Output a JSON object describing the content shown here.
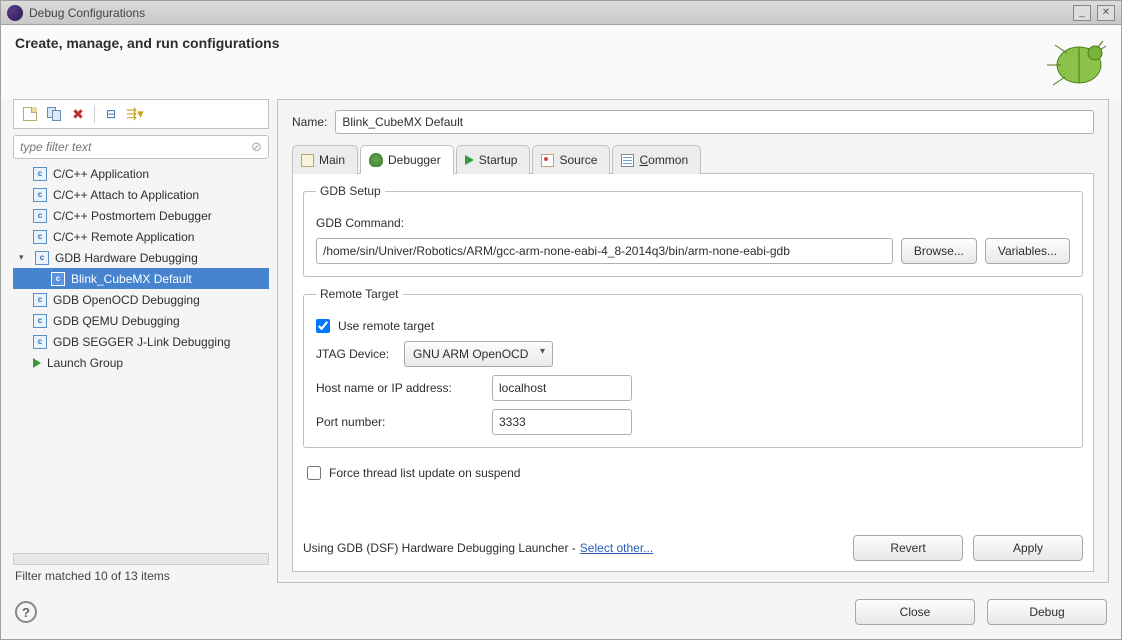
{
  "window": {
    "title": "Debug Configurations"
  },
  "header": {
    "title": "Create, manage, and run configurations"
  },
  "filter": {
    "placeholder": "type filter text"
  },
  "tree": {
    "items": [
      {
        "label": "C/C++ Application"
      },
      {
        "label": "C/C++ Attach to Application"
      },
      {
        "label": "C/C++ Postmortem Debugger"
      },
      {
        "label": "C/C++ Remote Application"
      },
      {
        "label": "GDB Hardware Debugging",
        "expanded": true
      },
      {
        "label": "Blink_CubeMX Default",
        "selected": true
      },
      {
        "label": "GDB OpenOCD Debugging"
      },
      {
        "label": "GDB QEMU Debugging"
      },
      {
        "label": "GDB SEGGER J-Link Debugging"
      },
      {
        "label": "Launch Group",
        "launch": true
      }
    ]
  },
  "filter_status": "Filter matched 10 of 13 items",
  "name": {
    "label": "Name:",
    "value": "Blink_CubeMX Default"
  },
  "tabs": {
    "main": "Main",
    "debugger": "Debugger",
    "startup": "Startup",
    "source": "Source",
    "common": "Common"
  },
  "gdb_setup": {
    "legend": "GDB Setup",
    "command_label": "GDB Command:",
    "command_value": "/home/sin/Univer/Robotics/ARM/gcc-arm-none-eabi-4_8-2014q3/bin/arm-none-eabi-gdb",
    "browse": "Browse...",
    "variables": "Variables..."
  },
  "remote": {
    "legend": "Remote Target",
    "use_remote": "Use remote target",
    "jtag_label": "JTAG Device:",
    "jtag_value": "GNU ARM OpenOCD",
    "host_label": "Host name or IP address:",
    "host_value": "localhost",
    "port_label": "Port number:",
    "port_value": "3333"
  },
  "force_thread": "Force thread list update on suspend",
  "launcher": {
    "prefix": "Using GDB (DSF) Hardware Debugging Launcher - ",
    "link": "Select other..."
  },
  "buttons": {
    "revert": "Revert",
    "apply": "Apply",
    "close": "Close",
    "debug": "Debug"
  }
}
